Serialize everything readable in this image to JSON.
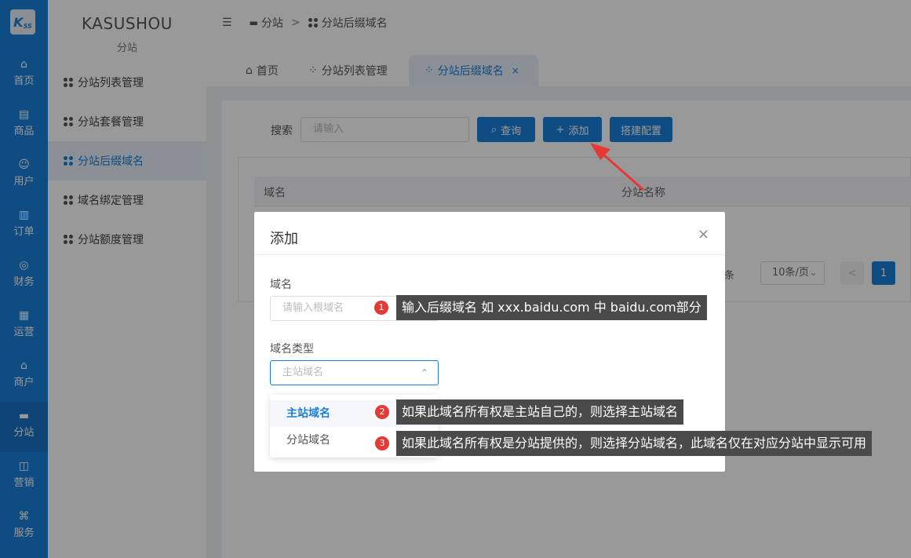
{
  "rail": {
    "logo": "K",
    "logo_sub": "SS",
    "items": [
      {
        "label": "首页",
        "icon": "home-icon",
        "glyph": "⌂"
      },
      {
        "label": "商品",
        "icon": "product-icon",
        "glyph": "▤"
      },
      {
        "label": "用户",
        "icon": "user-icon",
        "glyph": "☺"
      },
      {
        "label": "订单",
        "icon": "order-icon",
        "glyph": "▥"
      },
      {
        "label": "财务",
        "icon": "finance-icon",
        "glyph": "◎"
      },
      {
        "label": "运营",
        "icon": "operation-icon",
        "glyph": "▦"
      },
      {
        "label": "商户",
        "icon": "merchant-icon",
        "glyph": "⌂"
      },
      {
        "label": "分站",
        "icon": "substation-icon",
        "glyph": "▬"
      },
      {
        "label": "营销",
        "icon": "marketing-icon",
        "glyph": "◫"
      },
      {
        "label": "服务",
        "icon": "service-icon",
        "glyph": "⌘"
      }
    ]
  },
  "sidebar": {
    "brand": "KASUSHOU",
    "subtitle": "分站",
    "items": [
      {
        "label": "分站列表管理"
      },
      {
        "label": "分站套餐管理"
      },
      {
        "label": "分站后缀域名"
      },
      {
        "label": "域名绑定管理"
      },
      {
        "label": "分站额度管理"
      }
    ]
  },
  "breadcrumb": {
    "items": [
      "分站",
      "分站后缀域名"
    ],
    "separator": ">"
  },
  "tabs": [
    {
      "label": "首页"
    },
    {
      "label": "分站列表管理"
    },
    {
      "label": "分站后缀域名",
      "close": "×"
    }
  ],
  "toolbar": {
    "search_label": "搜索",
    "search_placeholder": "请输入",
    "query_label": "查询",
    "add_label": "添加",
    "config_label": "搭建配置"
  },
  "table": {
    "columns": [
      "域名",
      "分站名称"
    ]
  },
  "pager": {
    "total_suffix": "条",
    "page_size": "10条/页",
    "current_page": "1",
    "prev": "<"
  },
  "dialog": {
    "title": "添加",
    "close": "×",
    "domain_label": "域名",
    "domain_placeholder": "请输入根域名",
    "type_label": "域名类型",
    "type_placeholder": "主站域名",
    "options": [
      "主站域名",
      "分站域名"
    ],
    "selected_option": "主站域名"
  },
  "annotations": [
    {
      "num": "1",
      "text": "输入后缀域名 如 xxx.baidu.com 中 baidu.com部分"
    },
    {
      "num": "2",
      "text": "如果此域名所有权是主站自己的，则选择主站域名"
    },
    {
      "num": "3",
      "text": "如果此域名所有权是分站提供的，则选择分站域名，此域名仅在对应分站中显示可用"
    }
  ],
  "colors": {
    "primary": "#1a7fd8",
    "badge": "#e53935",
    "tooltip": "#4a4a4a"
  }
}
